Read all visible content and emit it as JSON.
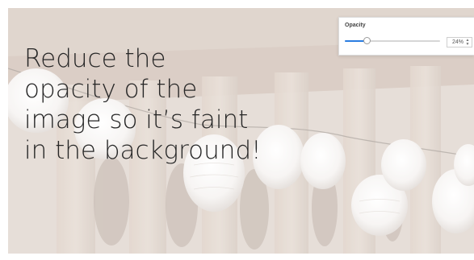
{
  "caption": {
    "lines": [
      "Reduce the",
      "opacity of the",
      "image so it’s faint",
      "in the background!"
    ]
  },
  "opacity_panel": {
    "label": "Opacity",
    "value_text": "24%",
    "value_percent": 24,
    "accent_color": "#2a7de1"
  },
  "icons": {
    "stepper_up": "chevron-up-icon",
    "stepper_down": "chevron-down-icon"
  }
}
